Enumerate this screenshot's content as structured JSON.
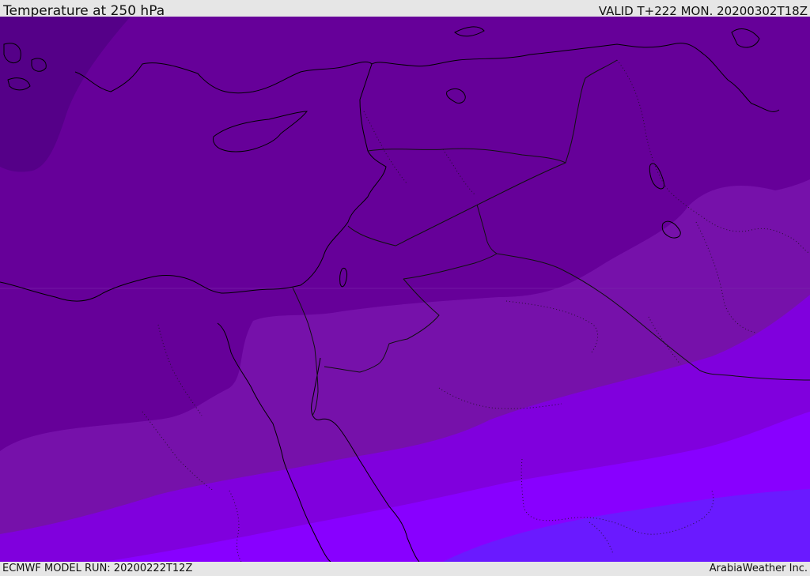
{
  "header": {
    "title": "Temperature at 250 hPa",
    "valid_time": "VALID T+222 MON. 20200302T18Z"
  },
  "footer": {
    "model_run": "ECMWF MODEL RUN: 20200222T12Z",
    "credit": "ArabiaWeather Inc."
  },
  "map": {
    "region": "Eastern Mediterranean / Levant / Egypt / Arabia",
    "colors": {
      "band_darkest": "#550088",
      "band_dark": "#660099",
      "band_mid": "#7711aa",
      "band_bright": "#8000dd",
      "band_brighter": "#8800ff",
      "band_blue": "#6a1aff",
      "coastline": "#000000",
      "borders": "#111111"
    },
    "features": [
      "coastlines",
      "country-borders",
      "dotted-province-borders",
      "temperature-bands"
    ]
  }
}
